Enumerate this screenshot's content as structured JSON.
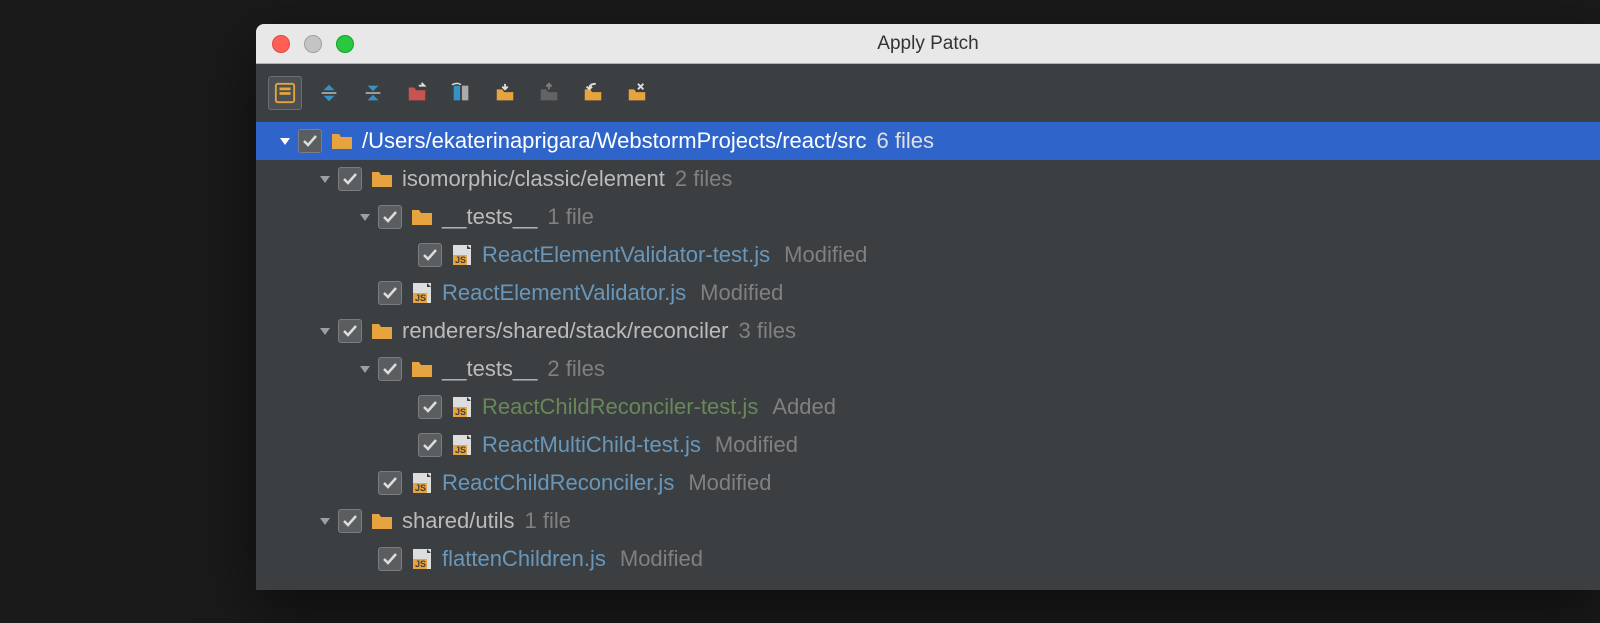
{
  "window": {
    "title": "Apply Patch"
  },
  "toolbar": [
    {
      "name": "group-by-directory-icon",
      "active": true
    },
    {
      "name": "expand-all-icon"
    },
    {
      "name": "collapse-all-icon"
    },
    {
      "name": "move-to-changelist-icon"
    },
    {
      "name": "show-diff-icon"
    },
    {
      "name": "include-icon"
    },
    {
      "name": "exclude-icon",
      "disabled": true
    },
    {
      "name": "rollback-icon"
    },
    {
      "name": "remove-icon"
    }
  ],
  "tree": [
    {
      "depth": 0,
      "kind": "folder-root",
      "expandable": true,
      "label": "/Users/ekaterinaprigara/WebstormProjects/react/src",
      "count": "6 files",
      "selected": true
    },
    {
      "depth": 1,
      "kind": "folder",
      "expandable": true,
      "label": "isomorphic/classic/element",
      "count": "2 files"
    },
    {
      "depth": 2,
      "kind": "folder",
      "expandable": true,
      "label": "__tests__",
      "count": "1 file"
    },
    {
      "depth": 3,
      "kind": "file-js",
      "label": "ReactElementValidator-test.js",
      "status": "Modified",
      "statusClass": "modified"
    },
    {
      "depth": 2,
      "kind": "file-js",
      "label": "ReactElementValidator.js",
      "status": "Modified",
      "statusClass": "modified"
    },
    {
      "depth": 1,
      "kind": "folder",
      "expandable": true,
      "label": "renderers/shared/stack/reconciler",
      "count": "3 files"
    },
    {
      "depth": 2,
      "kind": "folder",
      "expandable": true,
      "label": "__tests__",
      "count": "2 files"
    },
    {
      "depth": 3,
      "kind": "file-js",
      "label": "ReactChildReconciler-test.js",
      "status": "Added",
      "statusClass": "added"
    },
    {
      "depth": 3,
      "kind": "file-js",
      "label": "ReactMultiChild-test.js",
      "status": "Modified",
      "statusClass": "modified"
    },
    {
      "depth": 2,
      "kind": "file-js",
      "label": "ReactChildReconciler.js",
      "status": "Modified",
      "statusClass": "modified"
    },
    {
      "depth": 1,
      "kind": "folder",
      "expandable": true,
      "label": "shared/utils",
      "count": "1 file"
    },
    {
      "depth": 2,
      "kind": "file-js",
      "label": "flattenChildren.js",
      "status": "Modified",
      "statusClass": "modified"
    }
  ]
}
